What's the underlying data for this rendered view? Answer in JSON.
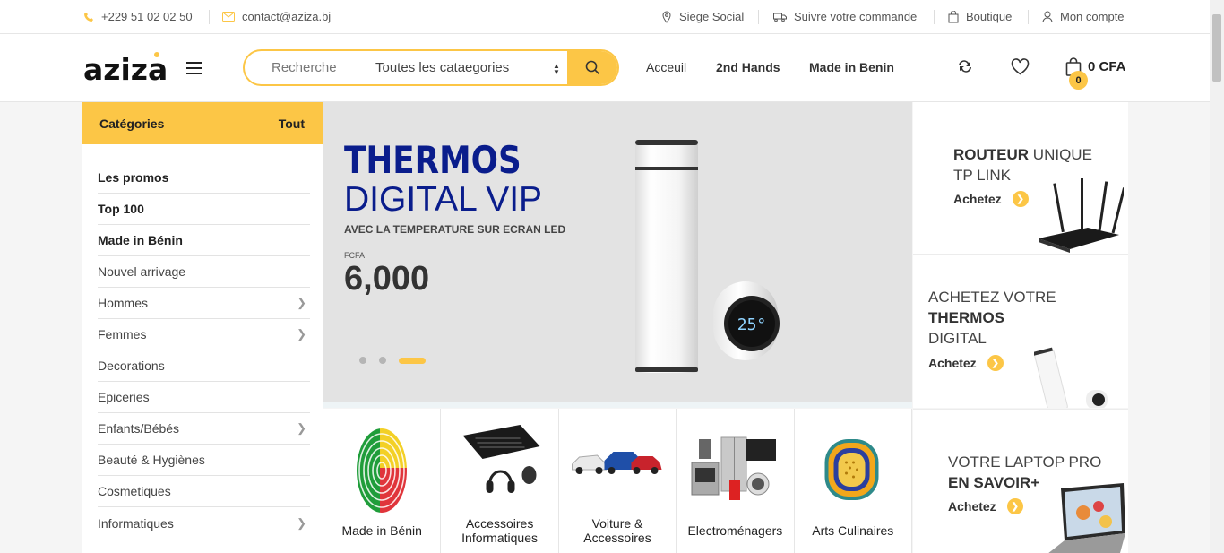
{
  "topbar": {
    "phone": "+229 51 02 02 50",
    "email": "contact@aziza.bj",
    "siege": "Siege Social",
    "suivre": "Suivre votre commande",
    "boutique": "Boutique",
    "compte": "Mon compte"
  },
  "header": {
    "logo": "aziza",
    "search_placeholder": "Recherche",
    "category_select": "Toutes les cataegories",
    "nav": [
      "Acceuil",
      "2nd Hands",
      "Made in Benin"
    ],
    "cart_count": "0",
    "cart_total": "0 CFA"
  },
  "sidebar": {
    "title": "Catégories",
    "all": "Tout",
    "items": [
      {
        "label": "Les promos",
        "bold": true,
        "chevron": false
      },
      {
        "label": "Top 100",
        "bold": true,
        "chevron": false
      },
      {
        "label": "Made in Bénin",
        "bold": true,
        "chevron": false
      },
      {
        "label": "Nouvel arrivage",
        "bold": false,
        "chevron": false
      },
      {
        "label": "Hommes",
        "bold": false,
        "chevron": true
      },
      {
        "label": "Femmes",
        "bold": false,
        "chevron": true
      },
      {
        "label": "Decorations",
        "bold": false,
        "chevron": false
      },
      {
        "label": "Epiceries",
        "bold": false,
        "chevron": false
      },
      {
        "label": "Enfants/Bébés",
        "bold": false,
        "chevron": true
      },
      {
        "label": "Beauté & Hygiènes",
        "bold": false,
        "chevron": false
      },
      {
        "label": "Cosmetiques",
        "bold": false,
        "chevron": false
      },
      {
        "label": "Informatiques",
        "bold": false,
        "chevron": true
      }
    ]
  },
  "banner": {
    "title1": "THERMOS",
    "title2": "DIGITAL VIP",
    "subtitle": "AVEC LA TEMPERATURE SUR ECRAN LED",
    "currency": "FCFA",
    "price": "6,000",
    "screen_temp": "25°"
  },
  "promos": [
    {
      "bold": "ROUTEUR",
      "rest": " UNIQUE",
      "line2": "TP LINK",
      "cta": "Achetez"
    },
    {
      "line1": "ACHETEZ VOTRE",
      "bold": "THERMOS",
      "line3": "DIGITAL",
      "cta": "Achetez"
    },
    {
      "line1": "VOTRE LAPTOP PRO",
      "bold": "EN SAVOIR+",
      "cta": "Achetez"
    }
  ],
  "tiles": [
    {
      "label": "Made in Bénin"
    },
    {
      "label": "Accessoires Informatiques"
    },
    {
      "label": "Voiture & Accessoires"
    },
    {
      "label": "Electroménagers"
    },
    {
      "label": "Arts Culinaires"
    }
  ],
  "colors": {
    "accent": "#fcc646",
    "banner_title": "#0a1d8c"
  }
}
